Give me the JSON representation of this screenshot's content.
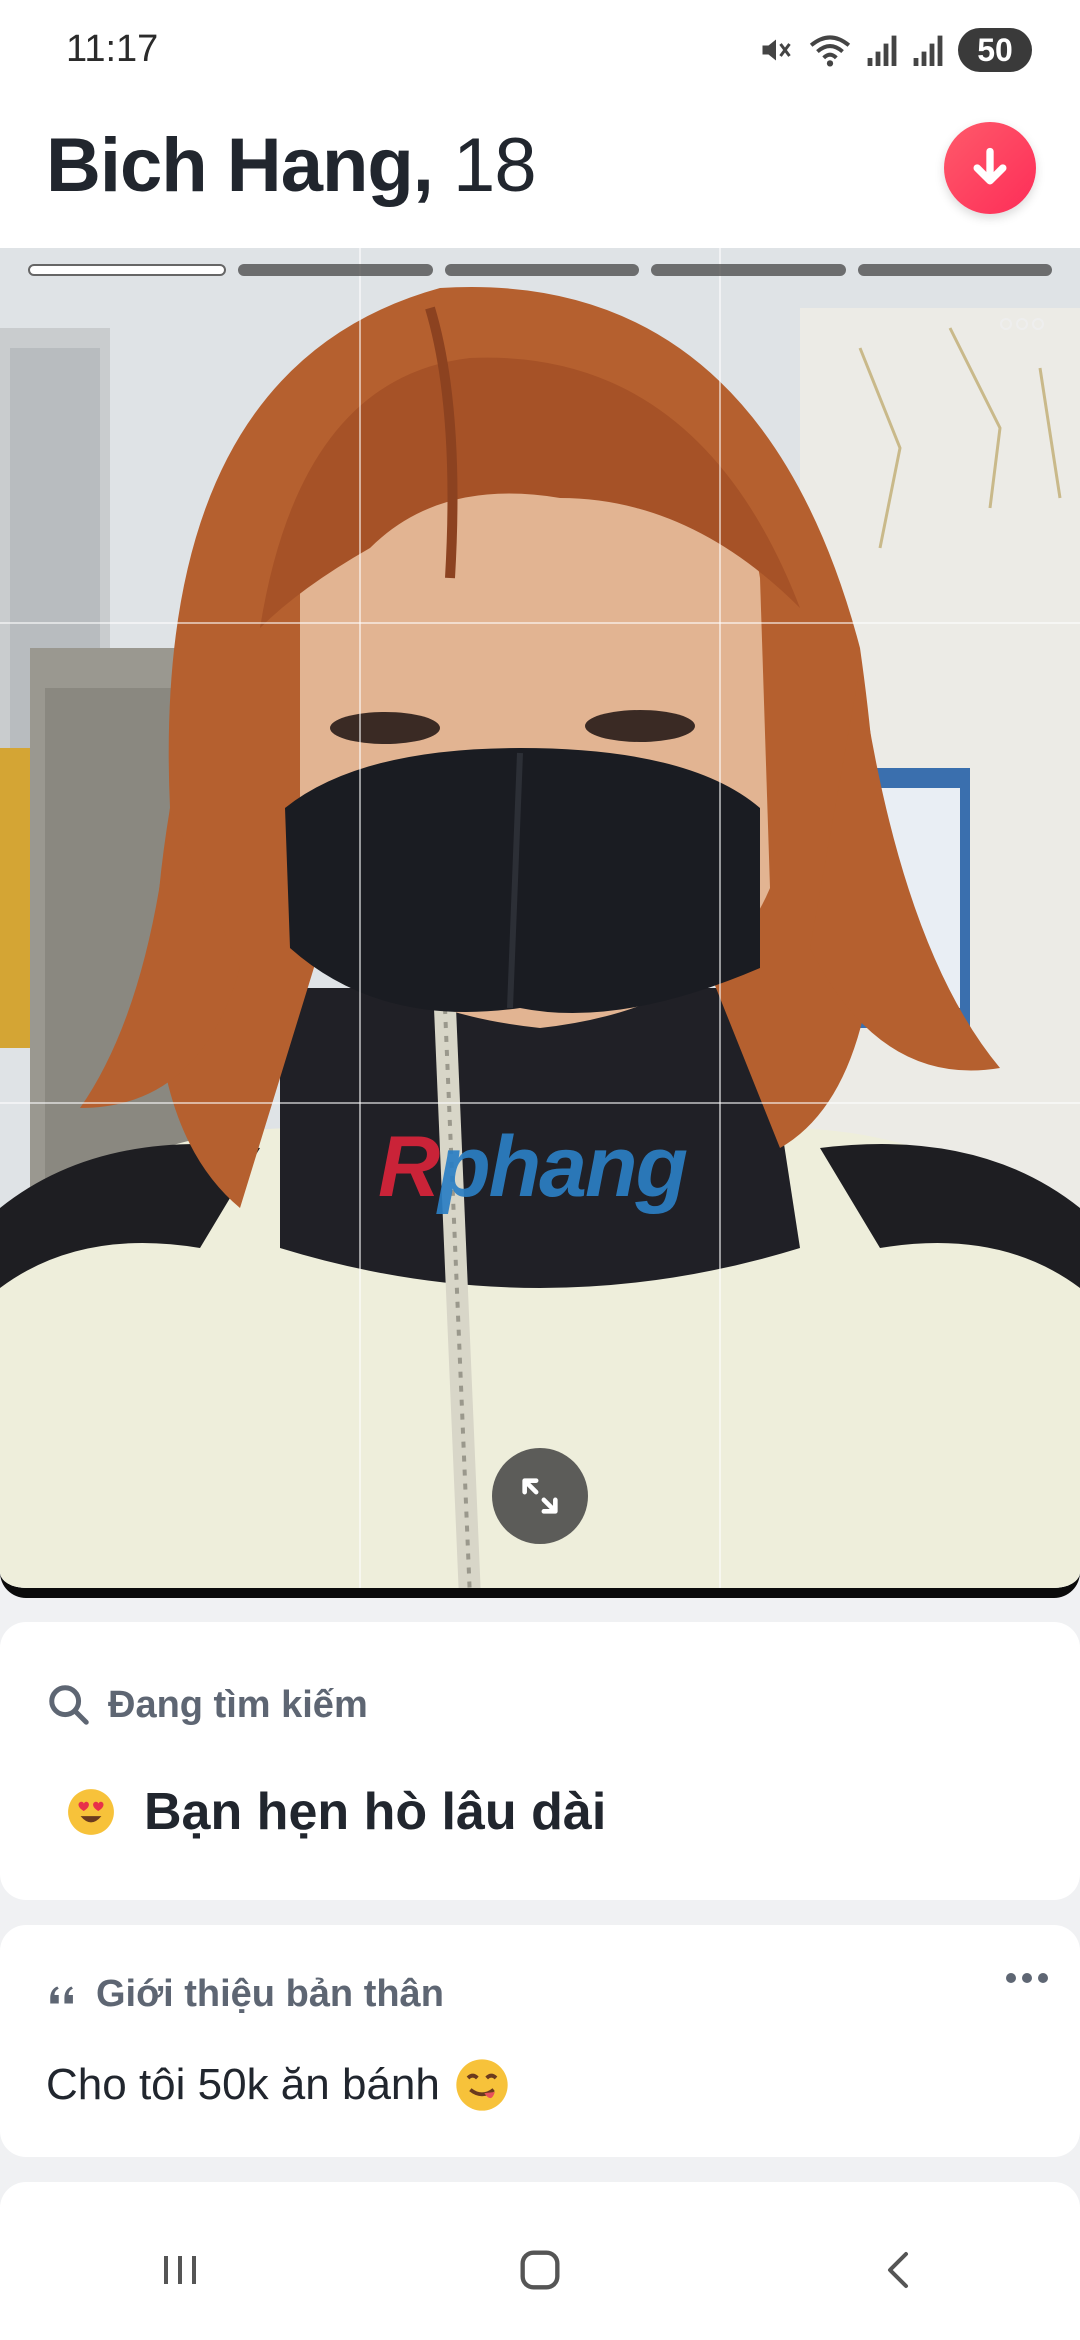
{
  "status_bar": {
    "time": "11:17",
    "battery": "50",
    "icons": [
      "mute-icon",
      "wifi-icon",
      "signal-icon",
      "signal-icon"
    ]
  },
  "profile": {
    "name": "Bich Hang,",
    "age": "18"
  },
  "photo": {
    "photo_count": 5,
    "current_photo": 1,
    "watermark_first": "R",
    "watermark_rest": "phang"
  },
  "looking_for": {
    "header": "Đang tìm kiếm",
    "value": "Bạn hẹn hò lâu dài",
    "icon": "heart-eyes-emoji-icon"
  },
  "about_me": {
    "header": "Giới thiệu bản thân",
    "text": "Cho tôi 50k ăn bánh",
    "icon": "quote-icon",
    "emoji": "yum-emoji-icon"
  },
  "colors": {
    "accent": "#fd2d58",
    "text_primary": "#21262e",
    "text_secondary": "#5e6673",
    "background": "#f0f1f3"
  }
}
